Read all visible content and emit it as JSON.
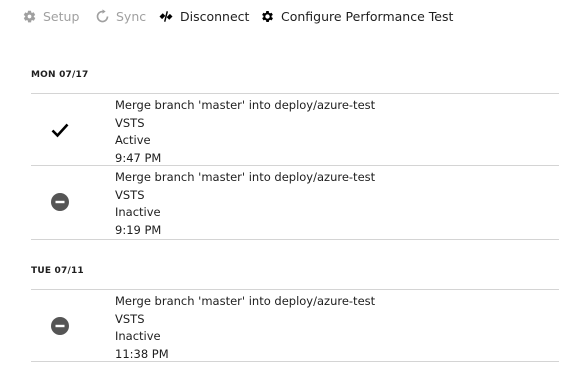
{
  "toolbar": {
    "setup": {
      "label": "Setup",
      "icon": "gear-icon",
      "enabled": false
    },
    "sync": {
      "label": "Sync",
      "icon": "refresh-icon",
      "enabled": false
    },
    "disconnect": {
      "label": "Disconnect",
      "icon": "disconnect-icon",
      "enabled": true
    },
    "configure": {
      "label": "Configure Performance Test",
      "icon": "gear-icon",
      "enabled": true
    }
  },
  "days": [
    {
      "header": "MON 07/17",
      "deployments": [
        {
          "message": "Merge branch 'master' into deploy/azure-test",
          "source": "VSTS",
          "status": "Active",
          "time": "9:47 PM",
          "status_icon": "checkmark-icon"
        },
        {
          "message": "Merge branch 'master' into deploy/azure-test",
          "source": "VSTS",
          "status": "Inactive",
          "time": "9:19 PM",
          "status_icon": "minus-circle-icon"
        }
      ]
    },
    {
      "header": "TUE 07/11",
      "deployments": [
        {
          "message": "Merge branch 'master' into deploy/azure-test",
          "source": "VSTS",
          "status": "Inactive",
          "time": "11:38 PM",
          "status_icon": "minus-circle-icon"
        }
      ]
    }
  ],
  "colors": {
    "disabled_text": "#a0a0a0",
    "text": "#1e1e1e",
    "divider": "#d4d4d4",
    "inactive_icon": "#555555"
  }
}
